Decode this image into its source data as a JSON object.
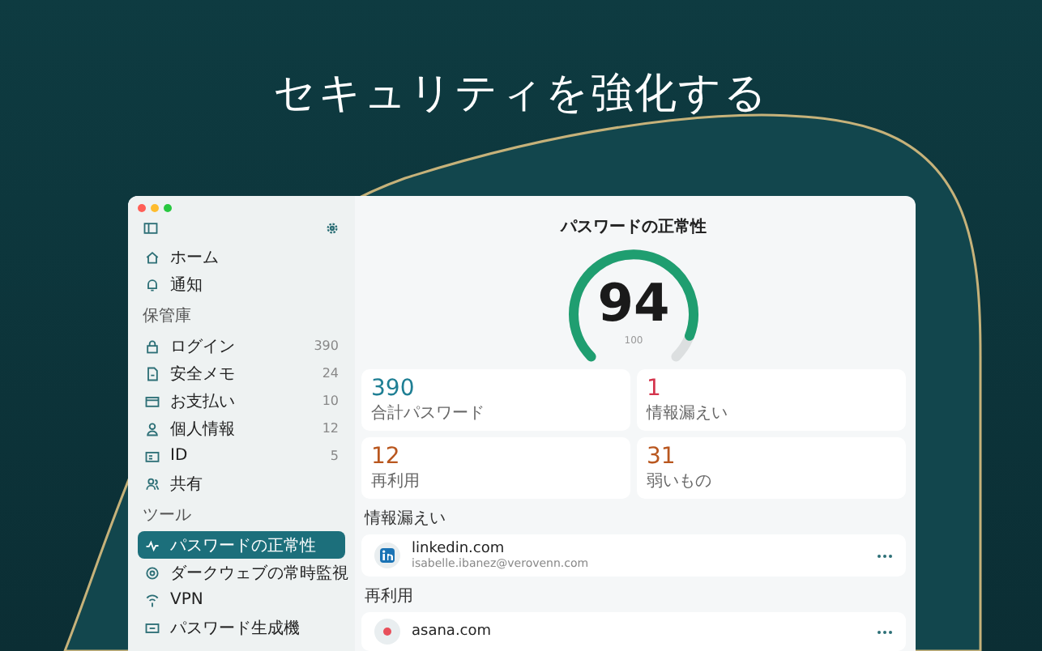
{
  "headline": "セキュリティを強化する",
  "sidebar": {
    "top": [
      {
        "label": "ホーム",
        "selected": false
      },
      {
        "label": "通知",
        "selected": false
      }
    ],
    "sections": [
      {
        "title": "保管庫",
        "items": [
          {
            "label": "ログイン",
            "count": "390",
            "selected": false
          },
          {
            "label": "安全メモ",
            "count": "24",
            "selected": false
          },
          {
            "label": "お支払い",
            "count": "10",
            "selected": false
          },
          {
            "label": "個人情報",
            "count": "12",
            "selected": false
          },
          {
            "label": "ID",
            "count": "5",
            "selected": false
          },
          {
            "label": "共有",
            "selected": false
          }
        ]
      },
      {
        "title": "ツール",
        "items": [
          {
            "label": "パスワードの正常性",
            "selected": true
          },
          {
            "label": "ダークウェブの常時監視",
            "selected": false
          },
          {
            "label": "VPN",
            "selected": false
          },
          {
            "label": "パスワード生成機",
            "selected": false
          }
        ]
      }
    ]
  },
  "main": {
    "title": "パスワードの正常性",
    "score": {
      "value": "94",
      "max": "100"
    },
    "stats": [
      {
        "value": "390",
        "label": "合計パスワード",
        "color": "#1f7f94"
      },
      {
        "value": "1",
        "label": "情報漏えい",
        "color": "#d4344c"
      },
      {
        "value": "12",
        "label": "再利用",
        "color": "#b9571f"
      },
      {
        "value": "31",
        "label": "弱いもの",
        "color": "#b9571f"
      }
    ],
    "sections": [
      {
        "title": "情報漏えい",
        "items": [
          {
            "site": "linkedin.com",
            "email": "isabelle.ibanez@verovenn.com",
            "kind": "linkedin"
          }
        ]
      },
      {
        "title": "再利用",
        "items": [
          {
            "site": "asana.com",
            "kind": "asana"
          }
        ]
      }
    ]
  }
}
